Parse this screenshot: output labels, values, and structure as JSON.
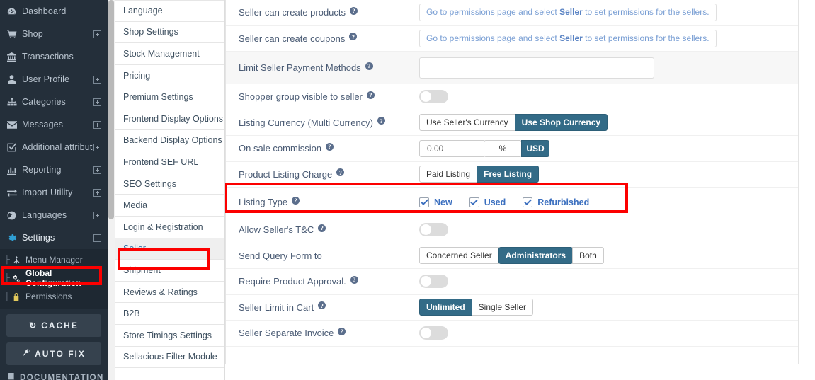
{
  "sidebar": {
    "items": [
      {
        "label": "Dashboard",
        "icon": "dashboard-icon",
        "expander": null
      },
      {
        "label": "Shop",
        "icon": "cart-icon",
        "expander": "plus"
      },
      {
        "label": "Transactions",
        "icon": "bank-icon",
        "expander": null
      },
      {
        "label": "User Profile",
        "icon": "user-icon",
        "expander": "plus"
      },
      {
        "label": "Categories",
        "icon": "sitemap-icon",
        "expander": "plus"
      },
      {
        "label": "Messages",
        "icon": "envelope-icon",
        "expander": "plus"
      },
      {
        "label": "Additional attribute",
        "icon": "checkbox-icon",
        "expander": "plus"
      },
      {
        "label": "Reporting",
        "icon": "bar-chart-icon",
        "expander": "plus"
      },
      {
        "label": "Import Utility",
        "icon": "exchange-icon",
        "expander": "plus"
      },
      {
        "label": "Languages",
        "icon": "globe-icon",
        "expander": "plus"
      },
      {
        "label": "Settings",
        "icon": "gear-icon",
        "expander": "minus"
      }
    ],
    "sub_items": [
      {
        "label": "Menu Manager",
        "icon": "menu-manager-icon",
        "highlighted": false
      },
      {
        "label": "Global Configuration",
        "icon": "gears-icon",
        "highlighted": true
      },
      {
        "label": "Permissions",
        "icon": "lock-icon",
        "highlighted": false
      }
    ],
    "buttons": [
      {
        "label": "CACHE",
        "icon": "refresh-icon"
      },
      {
        "label": "AUTO FIX",
        "icon": "wrench-icon"
      }
    ],
    "documentation": {
      "label": "DOCUMENTATION",
      "icon": "book-icon"
    },
    "bg_color": "#242f3a"
  },
  "menu_column": {
    "items": [
      {
        "label": "Language",
        "active": false
      },
      {
        "label": "Shop Settings",
        "active": false
      },
      {
        "label": "Stock Management",
        "active": false
      },
      {
        "label": "Pricing",
        "active": false
      },
      {
        "label": "Premium Settings",
        "active": false
      },
      {
        "label": "Frontend Display Options",
        "active": false
      },
      {
        "label": "Backend Display Options",
        "active": false
      },
      {
        "label": "Frontend SEF URL",
        "active": false
      },
      {
        "label": "SEO Settings",
        "active": false
      },
      {
        "label": "Media",
        "active": false
      },
      {
        "label": "Login & Registration",
        "active": false
      },
      {
        "label": "Seller",
        "active": true
      },
      {
        "label": "Shipment",
        "active": false
      },
      {
        "label": "Reviews & Ratings",
        "active": false
      },
      {
        "label": "B2B",
        "active": false
      },
      {
        "label": "Store Timings Settings",
        "active": false
      },
      {
        "label": "Sellacious Filter Module",
        "active": false
      }
    ]
  },
  "form": {
    "accent_color": "#336b87",
    "highlight_color": "#fc0000",
    "rows": {
      "seller_create_products": {
        "label": "Seller can create products",
        "note_prefix": "Go to permissions page and select ",
        "note_bold": "Seller",
        "note_suffix": " to set permissions for the sellers."
      },
      "seller_create_coupons": {
        "label": "Seller can create coupons",
        "note_prefix": "Go to permissions page and select ",
        "note_bold": "Seller",
        "note_suffix": " to set permissions for the sellers."
      },
      "limit_payment_methods": {
        "label": "Limit Seller Payment Methods",
        "value": "",
        "placeholder": ""
      },
      "shopper_group_visible": {
        "label": "Shopper group visible to seller",
        "toggle": "off"
      },
      "listing_currency": {
        "label": "Listing Currency (Multi Currency)",
        "options": [
          "Use Seller's Currency",
          "Use Shop Currency"
        ],
        "selected": "Use Shop Currency"
      },
      "on_sale_commission": {
        "label": "On sale commission",
        "value": "0.00",
        "unit": "%",
        "currency": "USD"
      },
      "product_listing_charge": {
        "label": "Product Listing Charge",
        "options": [
          "Paid Listing",
          "Free Listing"
        ],
        "selected": "Free Listing"
      },
      "listing_type": {
        "label": "Listing Type",
        "checkboxes": [
          {
            "label": "New",
            "checked": true
          },
          {
            "label": "Used",
            "checked": true
          },
          {
            "label": "Refurbished",
            "checked": true
          }
        ]
      },
      "allow_sellers_tc": {
        "label": "Allow Seller's T&C",
        "toggle": "off"
      },
      "send_query_form_to": {
        "label": "Send Query Form to",
        "options": [
          "Concerned Seller",
          "Administrators",
          "Both"
        ],
        "selected": "Administrators"
      },
      "require_product_approval": {
        "label": "Require Product Approval.",
        "toggle": "off"
      },
      "seller_limit_in_cart": {
        "label": "Seller Limit in Cart",
        "options": [
          "Unlimited",
          "Single Seller"
        ],
        "selected": "Unlimited"
      },
      "seller_separate_invoice": {
        "label": "Seller Separate Invoice",
        "toggle": "off"
      }
    }
  }
}
